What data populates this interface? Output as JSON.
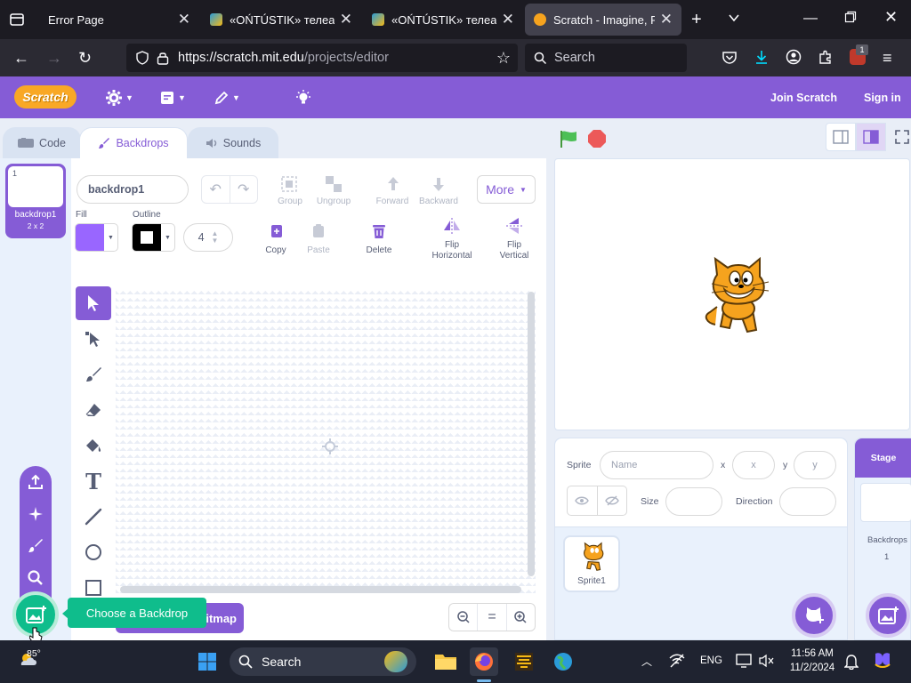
{
  "browser": {
    "tabs": [
      {
        "title": "Error Page",
        "active": false
      },
      {
        "title": "«OŃTÚSTIK» телеарна",
        "active": false
      },
      {
        "title": "«OŃTÚSTIK» телеарна",
        "active": false
      },
      {
        "title": "Scratch - Imagine, Prog",
        "active": true
      }
    ],
    "url_host": "https://scratch.mit.edu",
    "url_path": "/projects/editor",
    "search_placeholder": "Search",
    "ext_badge": "1"
  },
  "scratch_menu": {
    "logo": "Scratch",
    "join": "Join Scratch",
    "signin": "Sign in",
    "accent": "#855cd6"
  },
  "editor_tabs": {
    "code": "Code",
    "backdrops": "Backdrops",
    "sounds": "Sounds"
  },
  "backdrop_list": {
    "index": "1",
    "name": "backdrop1",
    "size": "2 x 2"
  },
  "paint": {
    "costume_name": "backdrop1",
    "group": "Group",
    "ungroup": "Ungroup",
    "forward": "Forward",
    "backward": "Backward",
    "more": "More",
    "fill_label": "Fill",
    "outline_label": "Outline",
    "outline_width": "4",
    "copy": "Copy",
    "paste": "Paste",
    "delete": "Delete",
    "flip_h": "Flip\nHorizontal",
    "flip_v": "Flip\nVertical",
    "convert": "itmap",
    "fill_color": "#9966ff",
    "outline_color": "#000000"
  },
  "tooltip": {
    "text": "Choose a Backdrop"
  },
  "sprite_info": {
    "sprite_label": "Sprite",
    "name_placeholder": "Name",
    "x_label": "x",
    "x_placeholder": "x",
    "y_label": "y",
    "y_placeholder": "y",
    "size_label": "Size",
    "direction_label": "Direction",
    "sprite_name": "Sprite1"
  },
  "stage_panel": {
    "title": "Stage",
    "backdrops_label": "Backdrops",
    "backdrops_count": "1"
  },
  "taskbar": {
    "temp": "85°",
    "search": "Search",
    "lang": "ENG",
    "time": "11:56 AM",
    "date": "11/2/2024"
  }
}
